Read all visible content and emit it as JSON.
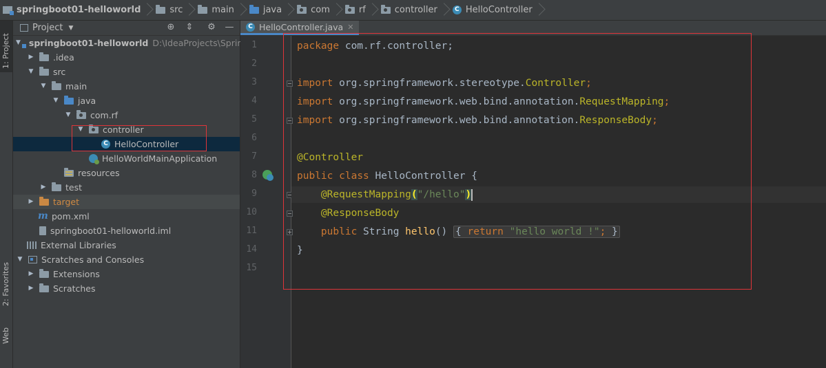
{
  "breadcrumb": [
    {
      "label": "springboot01-helloworld",
      "icon": "module-icon"
    },
    {
      "label": "src",
      "icon": "folder-icon"
    },
    {
      "label": "main",
      "icon": "folder-icon"
    },
    {
      "label": "java",
      "icon": "source-folder-icon"
    },
    {
      "label": "com",
      "icon": "package-icon"
    },
    {
      "label": "rf",
      "icon": "package-icon"
    },
    {
      "label": "controller",
      "icon": "package-icon"
    },
    {
      "label": "HelloController",
      "icon": "class-icon"
    }
  ],
  "side_tabs": {
    "project": "1: Project",
    "favorites": "2: Favorites",
    "web": "Web"
  },
  "panel": {
    "title": "Project"
  },
  "tree": {
    "root": {
      "label": "springboot01-helloworld",
      "path": "D:\\IdeaProjects\\Spring"
    },
    "idea": ".idea",
    "src": "src",
    "main": "main",
    "java": "java",
    "comrf": "com.rf",
    "controller": "controller",
    "hello_controller": "HelloController",
    "main_app": "HelloWorldMainApplication",
    "resources": "resources",
    "test": "test",
    "target": "target",
    "pom": "pom.xml",
    "iml": "springboot01-helloworld.iml",
    "ext_libs": "External Libraries",
    "scratches_consoles": "Scratches and Consoles",
    "extensions": "Extensions",
    "scratches": "Scratches"
  },
  "editor": {
    "tab_label": "HelloController.java",
    "line_numbers": [
      "1",
      "2",
      "3",
      "4",
      "5",
      "6",
      "7",
      "8",
      "9",
      "10",
      "11",
      "14",
      "15"
    ],
    "code": {
      "l1_kw": "package",
      "l1_rest": " com.rf.controller;",
      "import_kw": "import",
      "l3_pkg": " org.springframework.stereotype.",
      "l3_cls": "Controller",
      "l4_pkg": " org.springframework.web.bind.annotation.",
      "l4_cls": "RequestMapping",
      "l5_pkg": " org.springframework.web.bind.annotation.",
      "l5_cls": "ResponseBody",
      "semi": ";",
      "l7_ann": "@Controller",
      "l8_kw1": "public",
      "l8_kw2": "class",
      "l8_name": " HelloController ",
      "l8_brace": "{",
      "l9_ann": "@RequestMapping",
      "l9_open": "(",
      "l9_str": "\"/hello\"",
      "l9_close": ")",
      "l10_ann": "@ResponseBody",
      "l11_kw": "public",
      "l11_type": " String ",
      "l11_fn": "hello",
      "l11_paren": "()",
      "l11_ob": "{",
      "l11_ret": "return",
      "l11_str": "\"hello world !\"",
      "l11_semi": ";",
      "l11_cb": "}",
      "l14_brace": "}"
    }
  }
}
